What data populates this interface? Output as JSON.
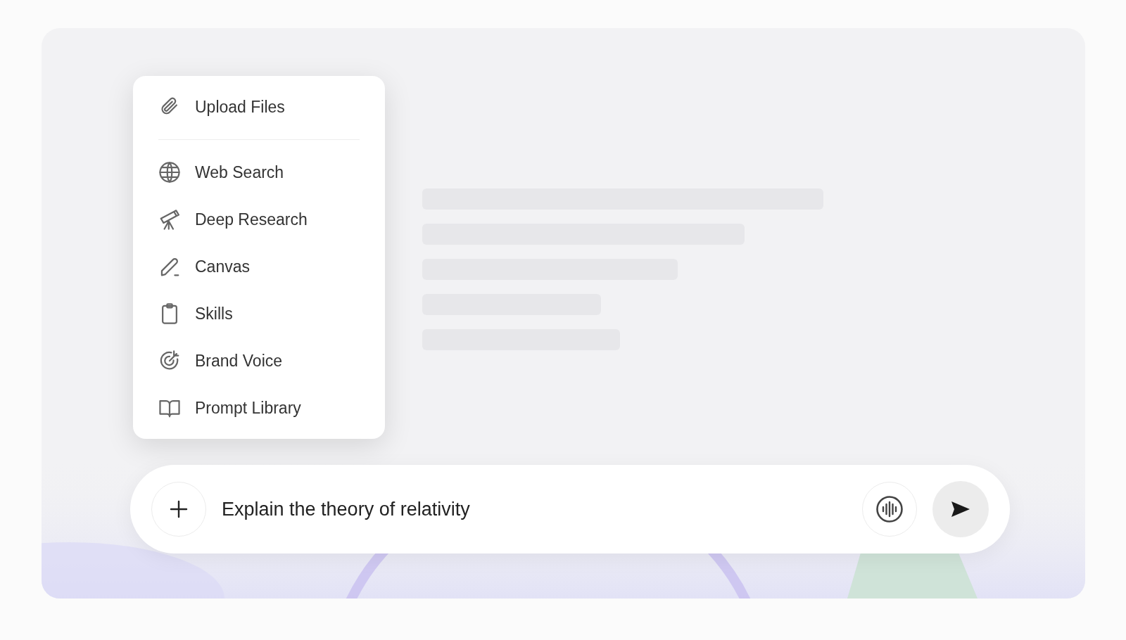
{
  "attach_menu": {
    "groups": [
      {
        "items": [
          {
            "label": "Upload Files"
          }
        ]
      },
      {
        "items": [
          {
            "label": "Web Search"
          },
          {
            "label": "Deep Research"
          },
          {
            "label": "Canvas"
          },
          {
            "label": "Skills"
          },
          {
            "label": "Brand Voice"
          },
          {
            "label": "Prompt Library"
          }
        ]
      }
    ]
  },
  "composer": {
    "value": "Explain the theory of relativity"
  }
}
